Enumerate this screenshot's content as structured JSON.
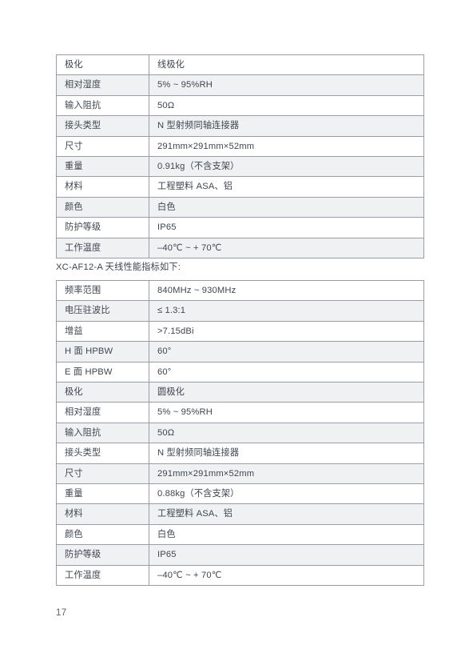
{
  "page": {
    "number": "17"
  },
  "section_heading": "XC-AF12-A 天线性能指标如下:",
  "tables": [
    {
      "id": "polarization-continued",
      "rows": [
        {
          "label": "极化",
          "value": "线极化"
        },
        {
          "label": "相对湿度",
          "value": "5% ~ 95%RH"
        },
        {
          "label": "输入阻抗",
          "value": "50Ω"
        },
        {
          "label": "接头类型",
          "value": "N 型射频同轴连接器"
        },
        {
          "label": "尺寸",
          "value": "291mm×291mm×52mm"
        },
        {
          "label": "重量",
          "value": "0.91kg（不含支架）"
        },
        {
          "label": "材料",
          "value": "工程塑料 ASA、铝"
        },
        {
          "label": "颜色",
          "value": "白色"
        },
        {
          "label": "防护等级",
          "value": "IP65"
        },
        {
          "label": "工作温度",
          "value": "–40℃ ~ + 70℃"
        }
      ]
    },
    {
      "id": "xc-af12-a",
      "rows": [
        {
          "label": "频率范围",
          "value": "840MHz ~ 930MHz"
        },
        {
          "label": "电压驻波比",
          "value": "≤ 1.3:1"
        },
        {
          "label": "增益",
          "value": ">7.15dBi"
        },
        {
          "label": "H 面 HPBW",
          "value": "60°"
        },
        {
          "label": "E 面 HPBW",
          "value": "60°"
        },
        {
          "label": "极化",
          "value": "圆极化"
        },
        {
          "label": "相对湿度",
          "value": "5% ~ 95%RH"
        },
        {
          "label": "输入阻抗",
          "value": "50Ω"
        },
        {
          "label": "接头类型",
          "value": "N 型射频同轴连接器"
        },
        {
          "label": "尺寸",
          "value": "291mm×291mm×52mm"
        },
        {
          "label": "重量",
          "value": "0.88kg（不含支架）"
        },
        {
          "label": "材料",
          "value": "工程塑料 ASA、铝"
        },
        {
          "label": "颜色",
          "value": "白色"
        },
        {
          "label": "防护等级",
          "value": "IP65"
        },
        {
          "label": "工作温度",
          "value": "–40℃ ~ + 70℃"
        }
      ]
    }
  ],
  "colors": {
    "text": "#3f4650",
    "border": "#9a9da3",
    "stripe": "#f0f1f3",
    "page_background": "#ffffff"
  }
}
